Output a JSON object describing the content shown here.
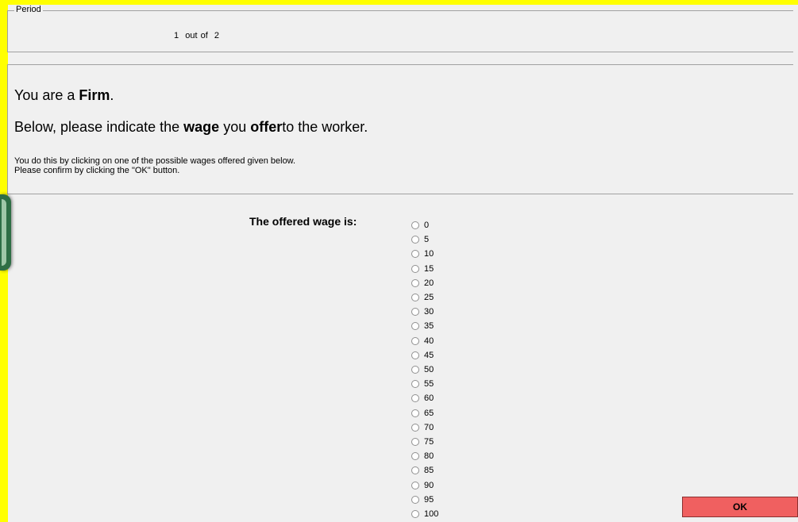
{
  "period": {
    "legend": "Period",
    "current": "1",
    "separator": "out of",
    "total": "2"
  },
  "instructions": {
    "role_prefix": "You are a ",
    "role": "Firm",
    "role_suffix": ".",
    "line2_prefix": "Below, please indicate the ",
    "line2_wage": "wage",
    "line2_middle": " you ",
    "line2_offer": "offer",
    "line2_suffix": "to the worker.",
    "detail1": "You do this by clicking on one of the possible wages offered given below.",
    "detail2": "Please confirm by clicking the \"OK\" button."
  },
  "wage": {
    "label": "The offered wage is:",
    "options": [
      "0",
      "5",
      "10",
      "15",
      "20",
      "25",
      "30",
      "35",
      "40",
      "45",
      "50",
      "55",
      "60",
      "65",
      "70",
      "75",
      "80",
      "85",
      "90",
      "95",
      "100"
    ],
    "selected": null
  },
  "ok_button": {
    "label": "OK",
    "color": "#f06060"
  },
  "colors": {
    "border": "#ffff00",
    "background": "#f0f0f0"
  }
}
